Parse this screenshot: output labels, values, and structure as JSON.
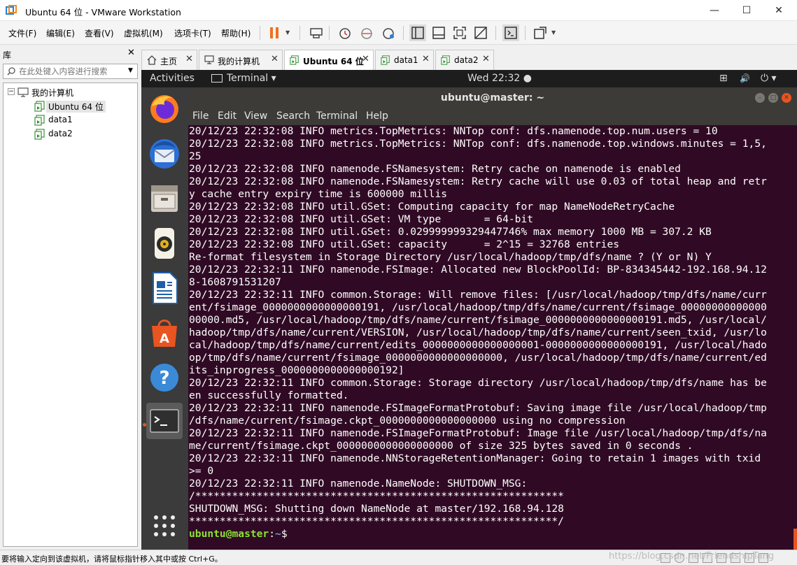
{
  "window": {
    "title": "Ubuntu 64 位 - VMware Workstation",
    "minimize_glyph": "—",
    "maximize_glyph": "☐",
    "close_glyph": "✕"
  },
  "menu": {
    "items": [
      "文件(F)",
      "编辑(E)",
      "查看(V)",
      "虚拟机(M)",
      "选项卡(T)",
      "帮助(H)"
    ]
  },
  "library": {
    "title": "库",
    "close_glyph": "✕",
    "search_placeholder": "在此处键入内容进行搜索",
    "tree": {
      "root": "我的计算机",
      "items": [
        "Ubuntu 64 位",
        "data1",
        "data2"
      ],
      "selected": "Ubuntu 64 位"
    }
  },
  "tabs": [
    {
      "label": "主页",
      "icon": "home-icon",
      "active": false
    },
    {
      "label": "我的计算机",
      "icon": "computer-icon",
      "active": false
    },
    {
      "label": "Ubuntu 64 位",
      "icon": "vm-icon",
      "active": true
    },
    {
      "label": "data1",
      "icon": "vm-icon",
      "active": false
    },
    {
      "label": "data2",
      "icon": "vm-icon",
      "active": false
    }
  ],
  "tab_close_glyph": "✕",
  "gnome": {
    "activities": "Activities",
    "app_menu": "Terminal ▾",
    "clock": "Wed 22:32 ●",
    "tray_network": "⊞",
    "tray_volume": "🔊",
    "tray_power": "⏻ ▾"
  },
  "dock": {
    "apps": [
      "firefox-icon",
      "thunderbird-icon",
      "files-icon",
      "rhythmbox-icon",
      "libreoffice-writer-icon",
      "software-center-icon",
      "help-icon",
      "terminal-icon"
    ],
    "show_apps": "grid-icon"
  },
  "terminal": {
    "title": "ubuntu@master: ~",
    "menu": [
      "File",
      "Edit",
      "View",
      "Search",
      "Terminal",
      "Help"
    ],
    "lines": [
      "20/12/23 22:32:08 INFO metrics.TopMetrics: NNTop conf: dfs.namenode.top.num.users = 10",
      "20/12/23 22:32:08 INFO metrics.TopMetrics: NNTop conf: dfs.namenode.top.windows.minutes = 1,5,",
      "25",
      "20/12/23 22:32:08 INFO namenode.FSNamesystem: Retry cache on namenode is enabled",
      "20/12/23 22:32:08 INFO namenode.FSNamesystem: Retry cache will use 0.03 of total heap and retr",
      "y cache entry expiry time is 600000 millis",
      "20/12/23 22:32:08 INFO util.GSet: Computing capacity for map NameNodeRetryCache",
      "20/12/23 22:32:08 INFO util.GSet: VM type       = 64-bit",
      "20/12/23 22:32:08 INFO util.GSet: 0.029999999329447746% max memory 1000 MB = 307.2 KB",
      "20/12/23 22:32:08 INFO util.GSet: capacity      = 2^15 = 32768 entries",
      "Re-format filesystem in Storage Directory /usr/local/hadoop/tmp/dfs/name ? (Y or N) Y",
      "20/12/23 22:32:11 INFO namenode.FSImage: Allocated new BlockPoolId: BP-834345442-192.168.94.12",
      "8-1608791531207",
      "20/12/23 22:32:11 INFO common.Storage: Will remove files: [/usr/local/hadoop/tmp/dfs/name/curr",
      "ent/fsimage_0000000000000000191, /usr/local/hadoop/tmp/dfs/name/current/fsimage_00000000000000",
      "00000.md5, /usr/local/hadoop/tmp/dfs/name/current/fsimage_0000000000000000191.md5, /usr/local/",
      "hadoop/tmp/dfs/name/current/VERSION, /usr/local/hadoop/tmp/dfs/name/current/seen_txid, /usr/lo",
      "cal/hadoop/tmp/dfs/name/current/edits_0000000000000000001-0000000000000000191, /usr/local/hado",
      "op/tmp/dfs/name/current/fsimage_0000000000000000000, /usr/local/hadoop/tmp/dfs/name/current/ed",
      "its_inprogress_0000000000000000192]",
      "20/12/23 22:32:11 INFO common.Storage: Storage directory /usr/local/hadoop/tmp/dfs/name has be",
      "en successfully formatted.",
      "20/12/23 22:32:11 INFO namenode.FSImageFormatProtobuf: Saving image file /usr/local/hadoop/tmp",
      "/dfs/name/current/fsimage.ckpt_0000000000000000000 using no compression",
      "20/12/23 22:32:11 INFO namenode.FSImageFormatProtobuf: Image file /usr/local/hadoop/tmp/dfs/na",
      "me/current/fsimage.ckpt_0000000000000000000 of size 325 bytes saved in 0 seconds .",
      "20/12/23 22:32:11 INFO namenode.NNStorageRetentionManager: Going to retain 1 images with txid",
      ">= 0",
      "20/12/23 22:32:11 INFO namenode.NameNode: SHUTDOWN_MSG:",
      "/************************************************************",
      "SHUTDOWN_MSG: Shutting down NameNode at master/192.168.94.128",
      "************************************************************/"
    ],
    "prompt": {
      "user_host": "ubuntu@master",
      "sep": ":",
      "path": "~",
      "symbol": "$"
    }
  },
  "status": {
    "text": "要将输入定向到该虚拟机，请将鼠标指针移入其中或按 Ctrl+G。",
    "watermark": "https://blog.csdn.net/FriendshipTang"
  },
  "colors": {
    "terminal_bg": "#300a24",
    "ubuntu_orange": "#e95420",
    "prompt_green": "#8ae234",
    "prompt_blue": "#729fcf"
  }
}
